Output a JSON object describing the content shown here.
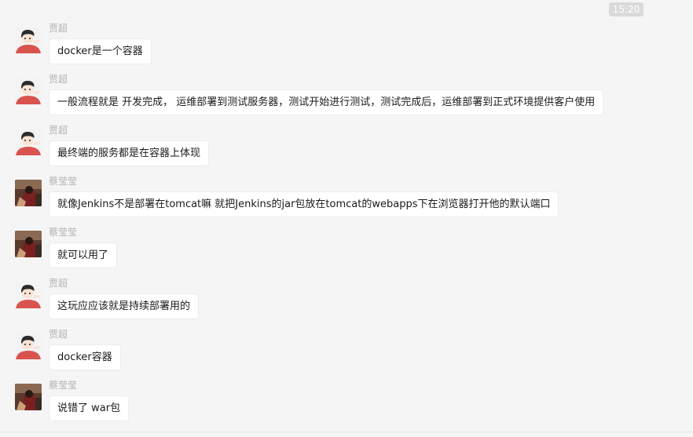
{
  "chat": {
    "timestamp": "15:20",
    "messages": [
      {
        "sender": "贾超",
        "text": "docker是一个容器",
        "avatar": "boy-avatar-icon"
      },
      {
        "sender": "贾超",
        "text": "一般流程就是 开发完成， 运维部署到测试服务器，测试开始进行测试，测试完成后，运维部署到正式环境提供客户使用",
        "avatar": "boy-avatar-icon"
      },
      {
        "sender": "贾超",
        "text": "最终端的服务都是在容器上体现",
        "avatar": "boy-avatar-icon"
      },
      {
        "sender": "蔡莹莹",
        "text": "就像Jenkins不是部署在tomcat嘛 就把Jenkins的jar包放在tomcat的webapps下在浏览器打开他的默认端口",
        "avatar": "photo-avatar-icon"
      },
      {
        "sender": "蔡莹莹",
        "text": "就可以用了",
        "avatar": "photo-avatar-icon"
      },
      {
        "sender": "贾超",
        "text": "这玩应应该就是持续部署用的",
        "avatar": "boy-avatar-icon"
      },
      {
        "sender": "贾超",
        "text": "docker容器",
        "avatar": "boy-avatar-icon"
      },
      {
        "sender": "蔡莹莹",
        "text": "说错了 war包",
        "avatar": "photo-avatar-icon"
      }
    ]
  },
  "colors": {
    "background": "#f5f5f5",
    "bubble": "#ffffff",
    "sender_name": "#b2b2b2",
    "timestamp_badge": "#dadada"
  }
}
